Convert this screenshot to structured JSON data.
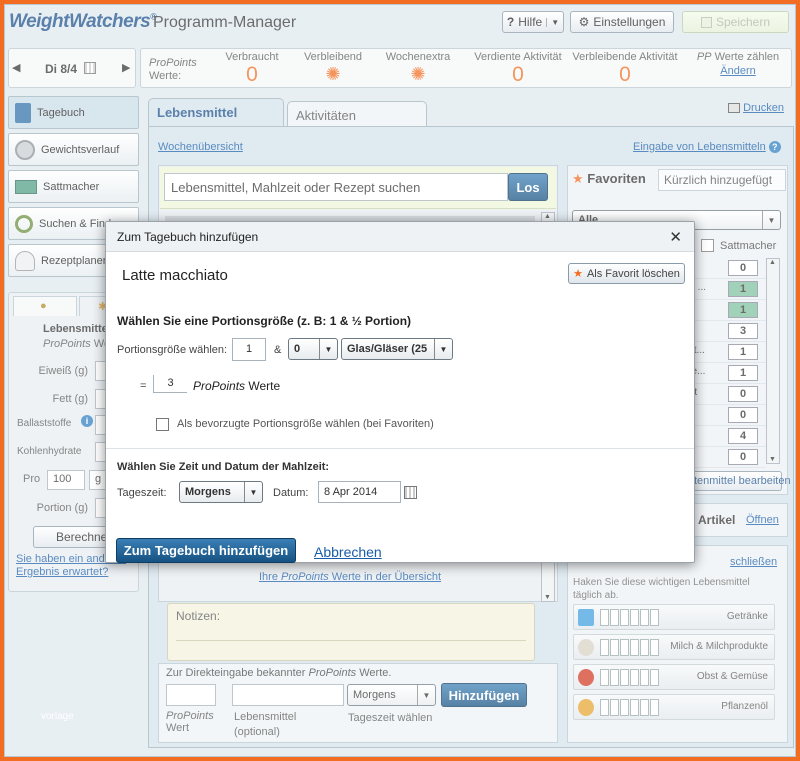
{
  "header": {
    "logo": "WeightWatchers",
    "logo_mark": "®",
    "app_title": "Programm-Manager",
    "help_label": "Hilfe",
    "settings_label": "Einstellungen",
    "save_label": "Speichern"
  },
  "datenav": {
    "day": "Di 8/4"
  },
  "stats": {
    "propoints_label": "ProPoints",
    "werte_label": "Werte:",
    "verbraucht_label": "Verbraucht",
    "verbraucht_value": "0",
    "verbleibend_label": "Verbleibend",
    "wochenextra_label": "Wochenextra",
    "verdiente_label": "Verdiente Aktivität",
    "verdiente_value": "0",
    "verbleibende_akt_label": "Verbleibende Aktivität",
    "verbleibende_akt_value": "0",
    "pp_label": "PP",
    "pp_suffix": "Werte zählen",
    "aendern": "Ändern"
  },
  "sidebar": {
    "items": [
      {
        "label": "Tagebuch"
      },
      {
        "label": "Gewichtsverlauf"
      },
      {
        "label": "Sattmacher"
      },
      {
        "label": "Suchen & Finden"
      },
      {
        "label": "Rezeptplaner"
      }
    ],
    "calc": {
      "title": "Lebensmittel",
      "subtitle_pp": "ProPoints",
      "subtitle_rest": "Werte",
      "eiweiss": "Eiweiß (g)",
      "fett": "Fett (g)",
      "ballast": "Ballaststoffe",
      "kohlen": "Kohlenhydrate",
      "pro": "Pro",
      "pro_value": "100",
      "pro_unit": "g",
      "portion": "Portion (g)",
      "berechnen": "Berechnen",
      "help_link": "Sie haben ein anderes Ergebnis erwartet?"
    },
    "footer": "vorlage"
  },
  "tabs": {
    "lebensmittel": "Lebensmittel",
    "aktivitaeten": "Aktivitäten",
    "drucken": "Drucken"
  },
  "main": {
    "wochen_link": "Wochenübersicht",
    "eingabe_link": "Eingabe von Lebensmitteln",
    "search_placeholder": "Lebensmittel, Mahlzeit oder Rezept suchen",
    "search_button": "Los",
    "overview_link_pre": "Ihre",
    "overview_link_pp": "ProPoints",
    "overview_link_post": "Werte in der Übersicht",
    "notes_label": "Notizen:",
    "direct_title_pre": "Zur Direkteingabe bekannter",
    "direct_title_pp": "ProPoints",
    "direct_title_post": "Werte.",
    "direct_pp": "ProPoints",
    "direct_wert": "Wert",
    "direct_lm": "Lebensmittel",
    "direct_optional": "(optional)",
    "direct_tz_value": "Morgens",
    "direct_tz_label": "Tageszeit wählen",
    "direct_add": "Hinzufügen"
  },
  "favorites": {
    "tab_fav": "Favoriten",
    "tab_recent": "Kürzlich hinzugefügt",
    "filter": "Alle",
    "sattmacher": "Sattmacher",
    "rows": [
      {
        "text": "",
        "value": "0"
      },
      {
        "text": "er ...",
        "value": "1"
      },
      {
        "text": "",
        "value": "1"
      },
      {
        "text": "",
        "value": "3"
      },
      {
        "text": "fst...",
        "value": "1"
      },
      {
        "text": "ne...",
        "value": "1"
      },
      {
        "text": "ett",
        "value": "0"
      },
      {
        "text": "",
        "value": "0"
      },
      {
        "text": "h",
        "value": "4"
      },
      {
        "text": "",
        "value": "0"
      }
    ],
    "edit_button": "Favoritenmittel bearbeiten",
    "artikel": "Artikel",
    "oeffnen": "Öffnen",
    "schliessen": "schließen",
    "guide_text": "Haken Sie diese wichtigen Lebensmittel täglich ab.",
    "guides": [
      {
        "label": "Getränke"
      },
      {
        "label": "Milch & Milchprodukte"
      },
      {
        "label": "Obst & Gemüse"
      },
      {
        "label": "Pflanzenöl"
      }
    ]
  },
  "modal": {
    "title": "Zum Tagebuch hinzufügen",
    "close": "✕",
    "item_name": "Latte macchiato",
    "fav_delete": "Als Favorit löschen",
    "portion_heading": "Wählen Sie eine Portionsgröße (z. B: 1 & ½ Portion)",
    "portion_label": "Portionsgröße wählen:",
    "portion_value": "1",
    "amp": "&",
    "fraction_value": "0",
    "unit_value": "Glas/Gläser (25",
    "equals": "=",
    "points_value": "3",
    "points_pp": "ProPoints",
    "points_werte": "Werte",
    "preferred_label": "Als bevorzugte Portionsgröße wählen (bei Favoriten)",
    "time_heading": "Wählen Sie Zeit und Datum der Mahlzeit:",
    "tageszeit_label": "Tageszeit:",
    "tageszeit_value": "Morgens",
    "datum_label": "Datum:",
    "datum_value": "8 Apr 2014",
    "submit": "Zum Tagebuch hinzufügen",
    "cancel": "Abbrechen"
  }
}
